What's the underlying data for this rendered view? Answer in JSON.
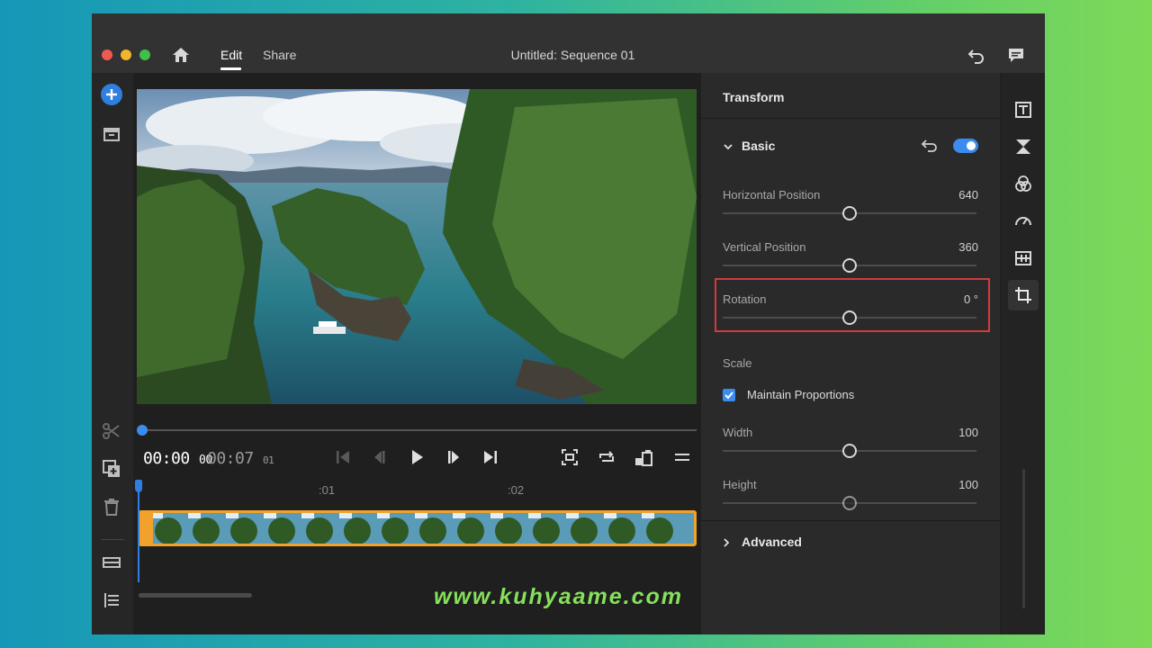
{
  "titlebar": {
    "tabs": [
      {
        "label": "Edit",
        "active": true
      },
      {
        "label": "Share",
        "active": false
      }
    ],
    "title": "Untitled: Sequence 01"
  },
  "transport": {
    "current_time": "00:00",
    "current_frames": "00",
    "total_time": "00:07",
    "total_frames": "01"
  },
  "timeline": {
    "ruler_marks": [
      ":01",
      ":02"
    ]
  },
  "panel": {
    "title": "Transform",
    "basic": {
      "label": "Basic",
      "enabled": true,
      "properties": [
        {
          "label": "Horizontal Position",
          "value": "640",
          "level": 0.5
        },
        {
          "label": "Vertical Position",
          "value": "360",
          "level": 0.5
        },
        {
          "label": "Rotation",
          "value": "0 °",
          "level": 0.5
        }
      ]
    },
    "scale": {
      "label": "Scale",
      "maintain_label": "Maintain Proportions",
      "maintain_checked": true,
      "properties": [
        {
          "label": "Width",
          "value": "100",
          "level": 0.5
        },
        {
          "label": "Height",
          "value": "100",
          "level": 0.5
        }
      ]
    },
    "advanced_label": "Advanced"
  },
  "watermark": "www.kuhyaame.com",
  "colors": {
    "accent": "#3b8bf0",
    "clip": "#f0a22a",
    "highlight": "#d33b3b"
  },
  "icons": {
    "left_toolbar": [
      "add-media-icon",
      "project-icon",
      "scissors-icon",
      "duplicate-icon",
      "trash-icon",
      "track-icon",
      "list-icon"
    ],
    "right_strip": [
      "title-icon",
      "transitions-icon",
      "color-icon",
      "speed-icon",
      "audio-icon",
      "crop-transform-icon"
    ]
  }
}
